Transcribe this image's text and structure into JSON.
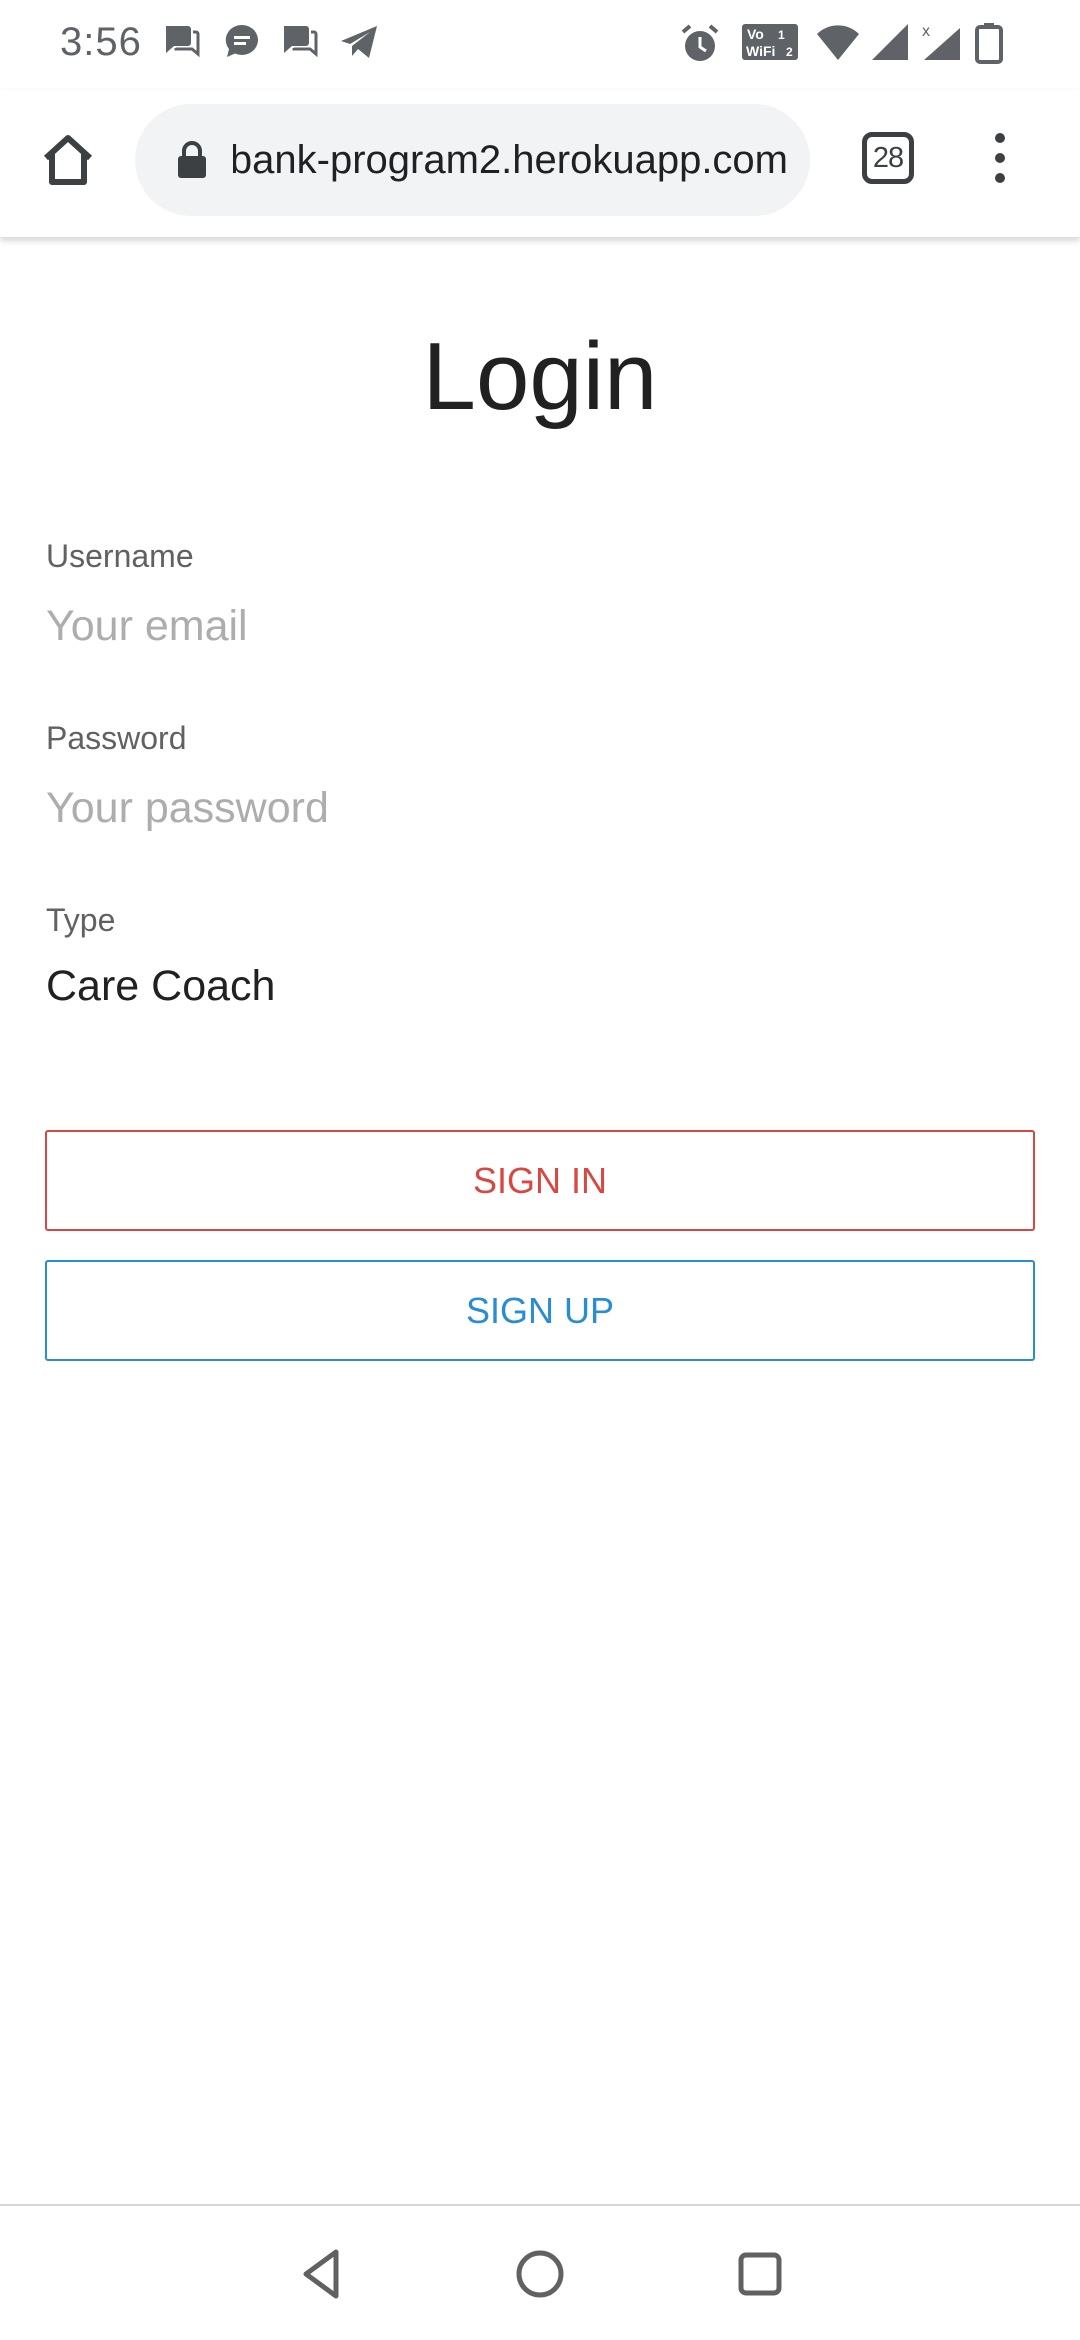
{
  "status_bar": {
    "time": "3:56",
    "notification_icons": [
      "chat-icon",
      "message-icon",
      "chat-icon",
      "telegram-icon"
    ],
    "system_icons": [
      "alarm-icon",
      "vowifi-icon",
      "wifi-icon",
      "cell-signal-icon",
      "cell-signal-icon",
      "battery-icon"
    ],
    "vowifi_text": "Vo WiFi 2"
  },
  "browser": {
    "url": "bank-program2.herokuapp.com",
    "tab_count": "28"
  },
  "form": {
    "title": "Login",
    "username_label": "Username",
    "username_placeholder": "Your email",
    "username_value": "",
    "password_label": "Password",
    "password_placeholder": "Your password",
    "password_value": "",
    "type_label": "Type",
    "type_value": "Care Coach",
    "signin_label": "SIGN IN",
    "signup_label": "SIGN UP"
  },
  "colors": {
    "signin_accent": "#d84843",
    "signup_accent": "#2a8dd4"
  },
  "nav": {
    "buttons": [
      "back-icon",
      "home-circle-icon",
      "recents-icon"
    ]
  }
}
